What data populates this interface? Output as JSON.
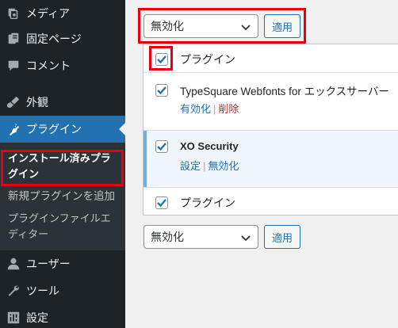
{
  "sidebar": {
    "items": [
      {
        "label": "メディア",
        "icon": "media-icon"
      },
      {
        "label": "固定ページ",
        "icon": "page-icon"
      },
      {
        "label": "コメント",
        "icon": "comment-icon"
      },
      {
        "label": "外観",
        "icon": "appearance-icon"
      },
      {
        "label": "プラグイン",
        "icon": "plugin-icon"
      },
      {
        "label": "ユーザー",
        "icon": "user-icon"
      },
      {
        "label": "ツール",
        "icon": "tools-icon"
      },
      {
        "label": "設定",
        "icon": "settings-icon"
      }
    ],
    "submenu": [
      {
        "label": "インストール済みプラグイン"
      },
      {
        "label": "新規プラグインを追加"
      },
      {
        "label": "プラグインファイルエディター"
      }
    ]
  },
  "bulk_actions_top": {
    "selected": "無効化",
    "apply_label": "適用"
  },
  "bulk_actions_bottom": {
    "selected": "無効化",
    "apply_label": "適用"
  },
  "table": {
    "header_label": "プラグイン",
    "footer_label": "プラグイン",
    "rows": [
      {
        "name": "TypeSquare Webfonts for エックスサーバー",
        "actions": [
          "有効化",
          "削除"
        ]
      },
      {
        "name": "XO Security",
        "actions": [
          "設定",
          "無効化"
        ]
      }
    ]
  },
  "colors": {
    "accent": "#2271b1",
    "highlight": "#e60012",
    "sidebar_bg": "#1d2327"
  }
}
